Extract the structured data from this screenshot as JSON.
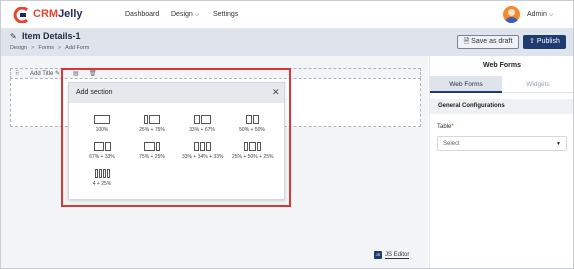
{
  "brand": {
    "name_part1": "CRM",
    "name_part2": "Jelly"
  },
  "nav": {
    "dashboard": "Dashboard",
    "design": "Design",
    "settings": "Settings"
  },
  "user": {
    "name": "Admin"
  },
  "page": {
    "title": "Item Details-1",
    "breadcrumb": [
      "Design",
      "Forms",
      "Add Form"
    ]
  },
  "actions": {
    "save_draft": "Save as draft",
    "publish": "Publish"
  },
  "canvas": {
    "add_title": "Add Title",
    "js_editor": "JS Editor"
  },
  "popup": {
    "title": "Add section",
    "options": [
      "100%",
      "25% + 75%",
      "33% + 67%",
      "50% + 50%",
      "67% + 33%",
      "75% + 25%",
      "33% + 34% + 33%",
      "25% + 50% + 25%",
      "4 + 25%"
    ]
  },
  "panel": {
    "title": "Web Forms",
    "tabs": [
      "Web Forms",
      "Widgets"
    ],
    "section": "General Configurations",
    "table_label": "Table",
    "table_required_mark": "*",
    "select_placeholder": "Select"
  },
  "colors": {
    "primary": "#1f3c70",
    "highlight": "#d9353a",
    "header_band": "#dfe4ec",
    "logo_accent": "#e8432e"
  }
}
